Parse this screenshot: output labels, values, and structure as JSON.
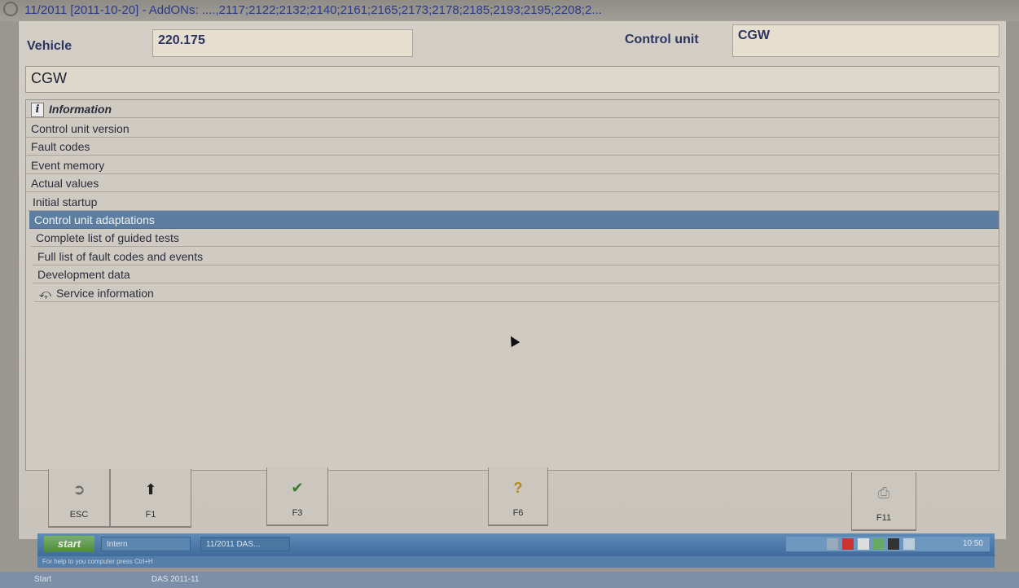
{
  "window": {
    "title": "11/2011 [2011-10-20] - AddONs: ....,2117;2122;2132;2140;2161;2165;2173;2178;2185;2193;2195;2208;2..."
  },
  "header": {
    "vehicle_label": "Vehicle",
    "vehicle_value": "220.175",
    "control_unit_label": "Control unit",
    "control_unit_value": "CGW"
  },
  "selected_unit": "CGW",
  "menu": {
    "heading": "Information",
    "items": [
      {
        "label": "Control unit version"
      },
      {
        "label": "Fault codes"
      },
      {
        "label": "Event memory"
      },
      {
        "label": "Actual values"
      },
      {
        "label": "Initial startup"
      },
      {
        "label": "Control unit adaptations",
        "selected": true
      },
      {
        "label": "Complete list of guided tests"
      },
      {
        "label": "Full list of fault codes and events"
      },
      {
        "label": "Development data"
      },
      {
        "label": "Service information",
        "icon": "wrench-icon"
      }
    ]
  },
  "function_keys": [
    {
      "key": "ESC",
      "icon": "exit-icon"
    },
    {
      "key": "F1",
      "icon": "arrow-up-icon"
    },
    {
      "key": "F3",
      "icon": "checkmark-icon"
    },
    {
      "key": "F6",
      "icon": "help-icon"
    },
    {
      "key": "F11",
      "icon": "printer-icon"
    }
  ],
  "taskbar": {
    "start_label": "start",
    "task1": "Intern",
    "task2": "11/2011 DAS...",
    "clock": "10:50"
  },
  "hint_text": "For help to you computer press Ctrl+H",
  "bottom_bar": {
    "start_label": "Start",
    "item": "DAS 2011-11"
  },
  "colors": {
    "selection": "#5d7ea0",
    "accent_text": "#2e3460"
  }
}
